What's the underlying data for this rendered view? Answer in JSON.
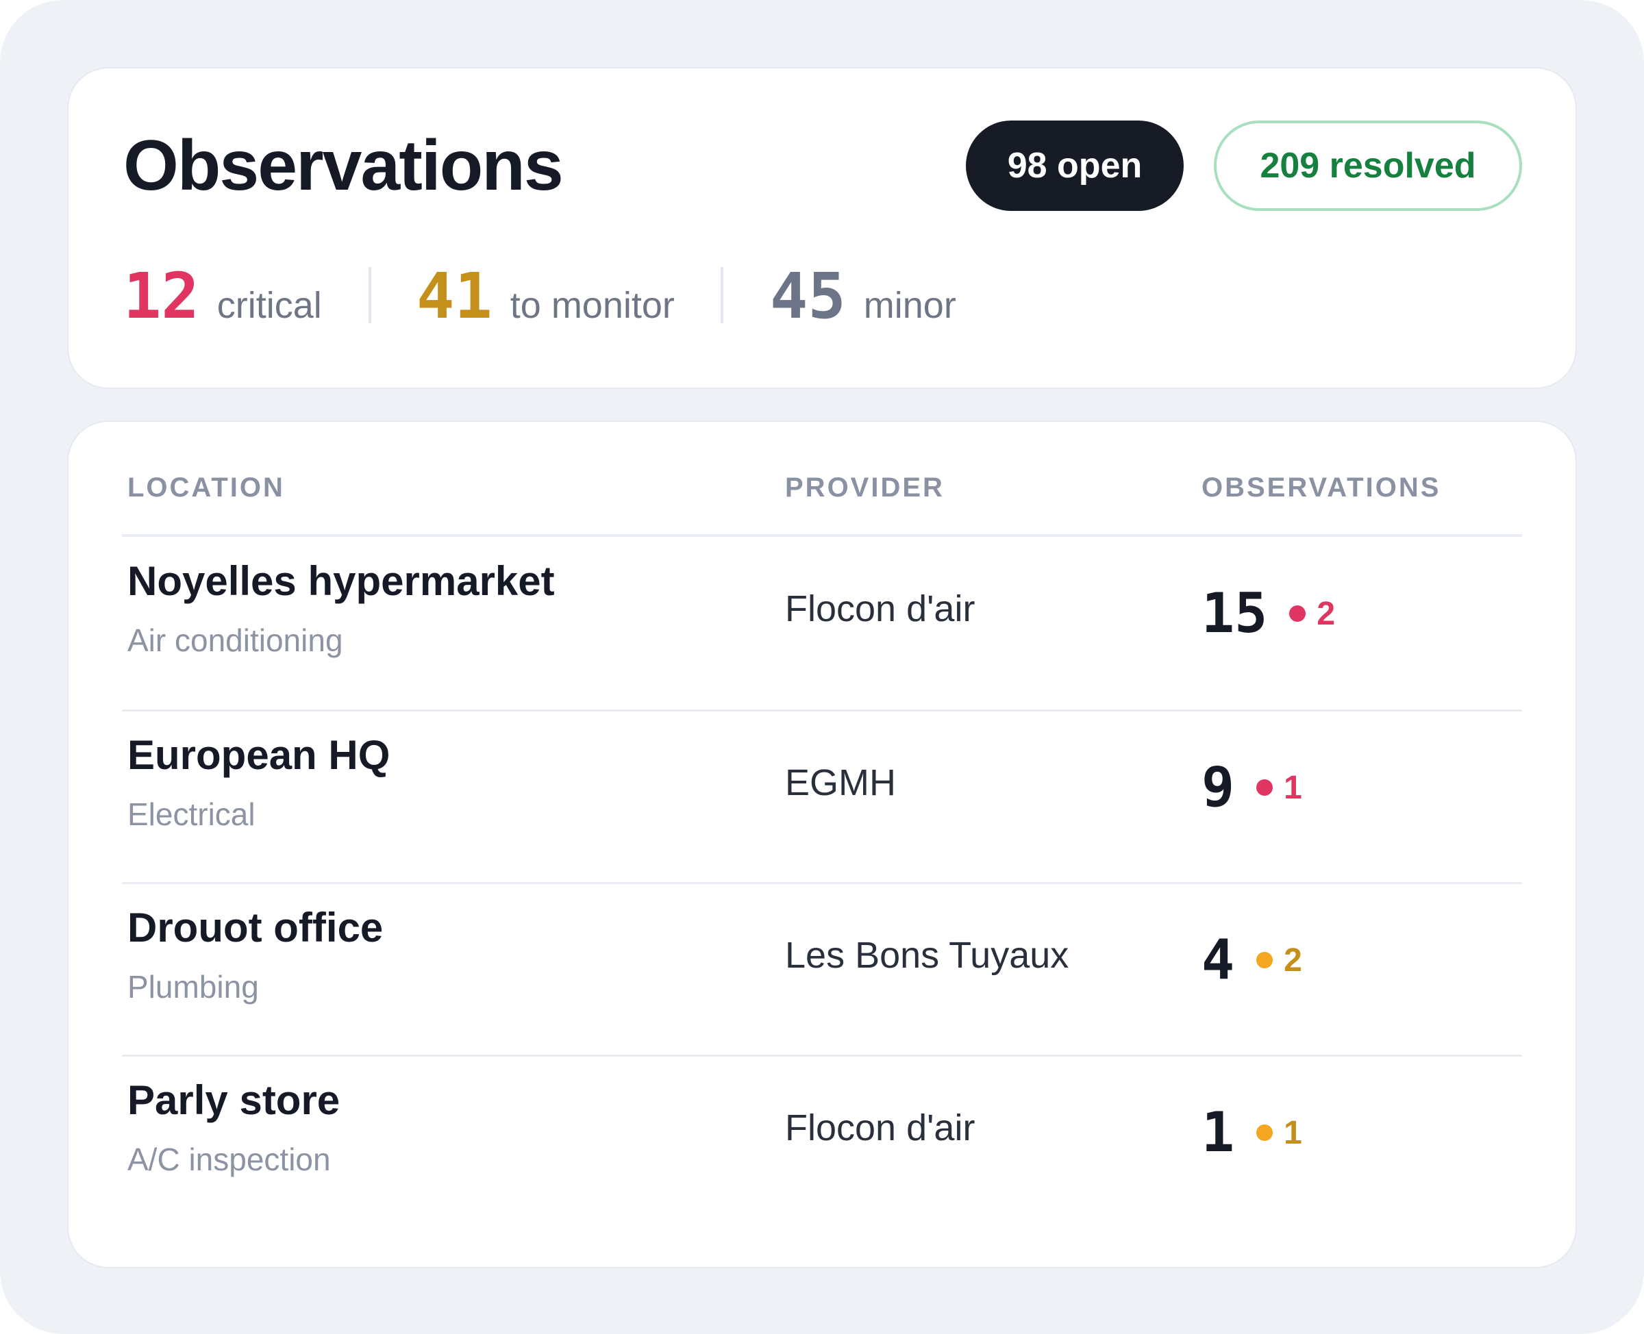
{
  "summary": {
    "title": "Observations",
    "open_badge": "98 open",
    "resolved_badge": "209 resolved",
    "colors": {
      "critical": "#e03560",
      "monitor": "#c48f1a",
      "minor": "#6c7487",
      "resolved": "#16803f"
    },
    "stats": [
      {
        "value": "12",
        "label": "critical"
      },
      {
        "value": "41",
        "label": "to monitor"
      },
      {
        "value": "45",
        "label": "minor"
      }
    ]
  },
  "table": {
    "headers": {
      "location": "LOCATION",
      "provider": "PROVIDER",
      "observations": "OBSERVATIONS"
    },
    "rows": [
      {
        "name": "Noyelles hypermarket",
        "type": "Air conditioning",
        "provider": "Flocon d'air",
        "count": "15",
        "flag": "2",
        "flag_color": "#e03560",
        "flag_text_color": "#e03560"
      },
      {
        "name": "European HQ",
        "type": "Electrical",
        "provider": "EGMH",
        "count": "9",
        "flag": "1",
        "flag_color": "#e03560",
        "flag_text_color": "#e03560"
      },
      {
        "name": "Drouot office",
        "type": "Plumbing",
        "provider": "Les Bons Tuyaux",
        "count": "4",
        "flag": "2",
        "flag_color": "#f5a623",
        "flag_text_color": "#c48f1a"
      },
      {
        "name": "Parly store",
        "type": "A/C inspection",
        "provider": "Flocon d'air",
        "count": "1",
        "flag": "1",
        "flag_color": "#f5a623",
        "flag_text_color": "#c48f1a"
      }
    ]
  }
}
